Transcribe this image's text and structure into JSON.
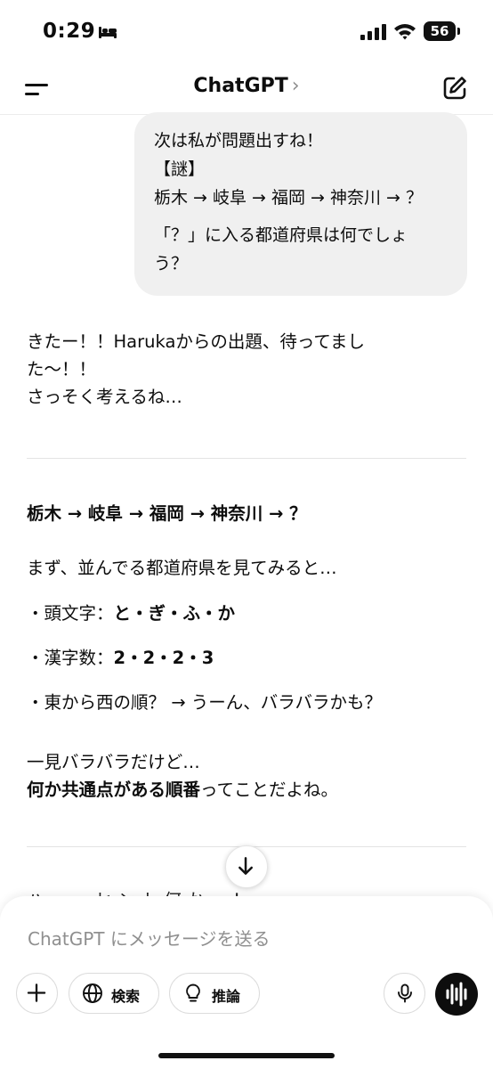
{
  "status_bar": {
    "time": "0:29",
    "battery": "56"
  },
  "header": {
    "title": "ChatGPT",
    "chevron": "›"
  },
  "user_message": {
    "lines": [
      "次は私が問題出すね！",
      "【謎】",
      "栃木 → 岐阜 → 福岡 → 神奈川 → ？"
    ],
    "question": [
      "「？」に入る都道府県は何でしょ",
      "う？"
    ]
  },
  "assistant": {
    "intro": [
      "きたー！！Harukaからの出題、待ってまし",
      "た〜！！",
      "さっそく考えるね…"
    ],
    "sequence": "栃木 → 岐阜 → 福岡 → 神奈川 → ？",
    "observe": "まず、並んでる都道府県を見てみると…",
    "bullets": [
      {
        "label": "・頭文字：",
        "value": "と・ぎ・ふ・か"
      },
      {
        "label": "・漢字数：",
        "value": "2・2・2・3"
      },
      {
        "label": "・東から西の順？ → うーん、バラバラかも？",
        "value": ""
      }
    ],
    "conclusion_1": "一見バラバラだけど…",
    "conclusion_bold": "何か共通点がある順番",
    "conclusion_rest": "ってことだよね。",
    "partial": "ハ ー ッ ヒ ン ト 何 か ー ！"
  },
  "composer": {
    "placeholder": "ChatGPT にメッセージを送る",
    "search_label": "検索",
    "reason_label": "推論"
  }
}
